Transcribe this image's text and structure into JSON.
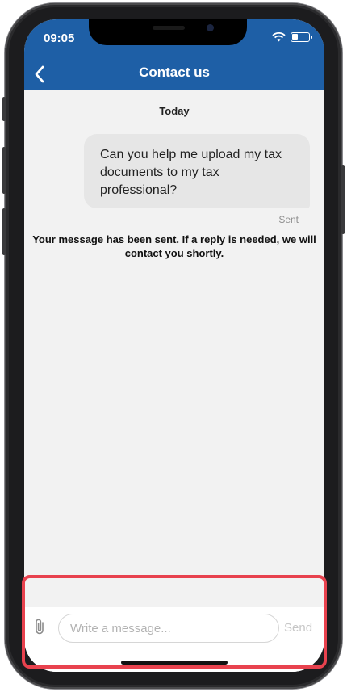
{
  "status_bar": {
    "time": "09:05",
    "wifi_icon": "wifi-icon",
    "battery_icon": "battery-icon"
  },
  "nav": {
    "title": "Contact us",
    "back_icon": "chevron-left-icon"
  },
  "chat": {
    "date_separator": "Today",
    "messages": [
      {
        "text": "Can you help me upload my tax documents to my tax professional?",
        "status": "Sent"
      }
    ],
    "notice": "Your message has been sent. If a reply is needed, we will contact you shortly."
  },
  "composer": {
    "attach_icon": "paperclip-icon",
    "placeholder": "Write a message...",
    "value": "",
    "send_label": "Send"
  },
  "colors": {
    "header": "#1e5fa6",
    "highlight": "#e8424e",
    "bubble": "#e6e6e6",
    "background": "#f2f2f2"
  }
}
